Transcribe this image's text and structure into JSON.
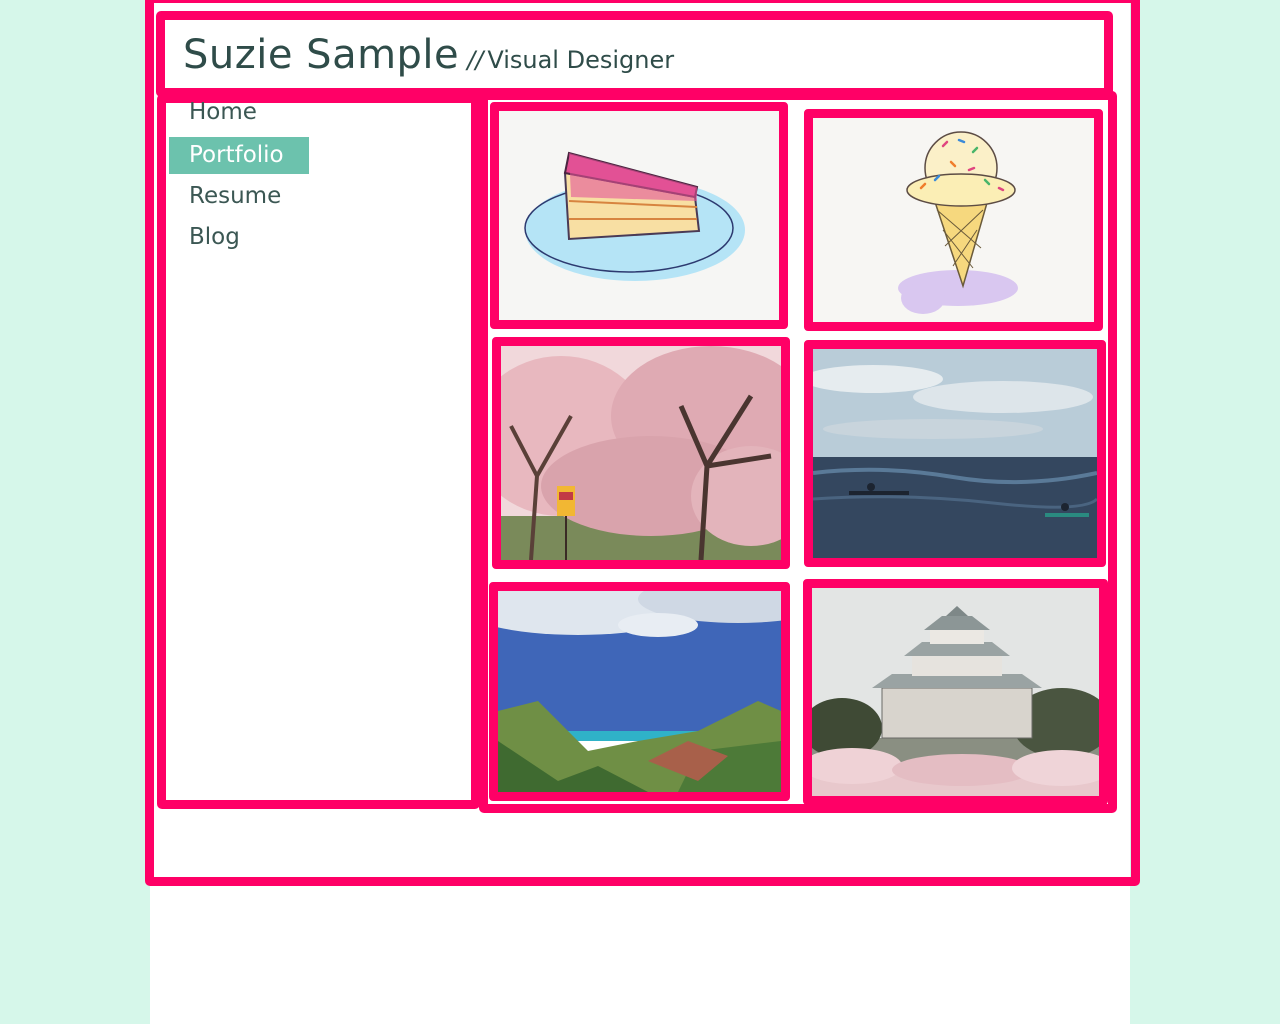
{
  "header": {
    "name": "Suzie Sample",
    "separator": "//",
    "role": "Visual Designer"
  },
  "nav": {
    "items": [
      {
        "label": "Home",
        "active": false
      },
      {
        "label": "Portfolio",
        "active": true
      },
      {
        "label": "Resume",
        "active": false
      },
      {
        "label": "Blog",
        "active": false
      }
    ]
  },
  "portfolio": {
    "tiles": [
      {
        "subject": "cake-slice-sketch"
      },
      {
        "subject": "ice-cream-cone-sketch"
      },
      {
        "subject": "cherry-blossom-trees-photo"
      },
      {
        "subject": "ocean-kayakers-photo"
      },
      {
        "subject": "coastal-valley-photo"
      },
      {
        "subject": "castle-photo"
      }
    ]
  },
  "colors": {
    "page_background": "#d6f7ea",
    "highlight_border": "#ff0066",
    "nav_active_bg": "#6cc2ad",
    "text": "#2f4c49"
  }
}
